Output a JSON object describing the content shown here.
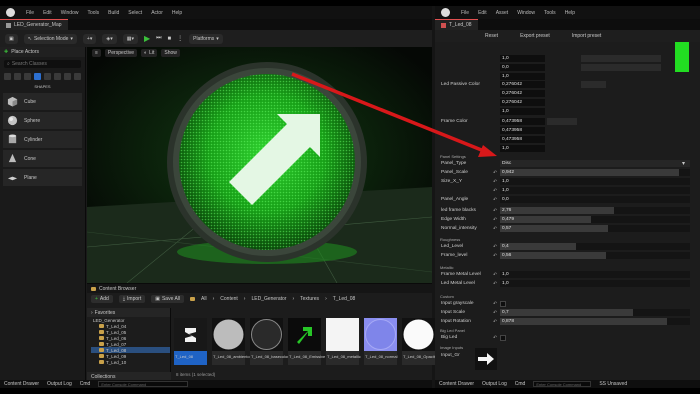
{
  "left_window": {
    "menu": [
      "File",
      "Edit",
      "Window",
      "Tools",
      "Build",
      "Select",
      "Actor",
      "Help"
    ],
    "tab_label": "LED_Generator_Map",
    "toolbar": {
      "selection_mode": "Selection Mode",
      "platforms": "Platforms"
    },
    "place_actors": {
      "title": "Place Actors",
      "search_placeholder": "Search Classes",
      "category": "SHAPES",
      "items": [
        "Cube",
        "Sphere",
        "Cylinder",
        "Cone",
        "Plane"
      ]
    },
    "viewport": {
      "perspective": "Perspective",
      "lit": "Lit",
      "show": "Show"
    },
    "content_browser": {
      "tab": "Content Browser",
      "add": "Add",
      "import": "Import",
      "save_all": "Save All",
      "path": [
        "All",
        "Content",
        "LED_Generator",
        "Textures",
        "T_Led_08"
      ],
      "favorites": "Favorites",
      "root": "LED_Generator",
      "folders": [
        "T_Led_04",
        "T_Led_05",
        "T_Led_06",
        "T_Led_07",
        "T_Led_08",
        "T_Led_09",
        "T_Led_10"
      ],
      "selected_folder": "T_Led_08",
      "collections": "Collections",
      "assets": [
        {
          "label": "T_Led_08"
        },
        {
          "label": "T_Led_08_ambientocclus"
        },
        {
          "label": "T_Led_08_basecolor"
        },
        {
          "label": "T_Led_08_Emissive"
        },
        {
          "label": "T_Led_08_metallic"
        },
        {
          "label": "T_Led_08_normal"
        },
        {
          "label": "T_Led_08_Opacity"
        }
      ],
      "summary": "8 items (1 selected)"
    },
    "status": {
      "drawer": "Content Drawer",
      "log": "Output Log",
      "cmd": "Cmd",
      "console": "Enter Console Command"
    }
  },
  "right_window": {
    "menu": [
      "File",
      "Edit",
      "Asset",
      "Window",
      "Tools",
      "Help"
    ],
    "tab_label": "T_Led_08",
    "toolbar": {
      "reset": "Reset",
      "export": "Export preset",
      "import": "Import preset"
    },
    "top_values": [
      "1,0",
      "0,0",
      "1,0"
    ],
    "passive_color": {
      "name": "Led Passive Color",
      "values": [
        "0,276042",
        "0,276042",
        "0,276042",
        "1,0"
      ]
    },
    "frame_color": {
      "name": "Frame Color",
      "values": [
        "0,473958",
        "0,473958",
        "0,473958",
        "1,0"
      ]
    },
    "sections": {
      "panel": "Panel Settings",
      "roughness": "Roughness",
      "metallic": "Metallic",
      "custom": "Custom",
      "big_led": "Big Led Panel",
      "image_inputs": "Image Inputs"
    },
    "panel_type": {
      "name": "Panel_Type",
      "value": "Disc"
    },
    "params": [
      {
        "name": "Panel_Scale",
        "value": "0,942"
      },
      {
        "name": "Size_X_Y",
        "value": "1,0"
      },
      {
        "name": "",
        "value": "1,0"
      },
      {
        "name": "Panel_Angle",
        "value": "0,0"
      },
      {
        "name": "led frame blacks",
        "value": "2,76"
      },
      {
        "name": "Edge Width",
        "value": "0,479"
      },
      {
        "name": "Normal_intensity",
        "value": "0,57"
      },
      {
        "name": "Led_Level",
        "value": "0,4"
      },
      {
        "name": "Frame_level",
        "value": "0,56"
      },
      {
        "name": "Frame Metal Level",
        "value": "1,0"
      },
      {
        "name": "Led Metal Level",
        "value": "1,0"
      },
      {
        "name": "Input grayscale",
        "value": ""
      },
      {
        "name": "Input Scale",
        "value": "0,7"
      },
      {
        "name": "Input Rotation",
        "value": "0,878"
      },
      {
        "name": "Big Led",
        "value": ""
      }
    ],
    "input_gr": "Input_Gr",
    "status": {
      "drawer": "Content Drawer",
      "log": "Output Log",
      "cmd": "Cmd",
      "console": "Enter Console Command",
      "source": "SS Unsaved"
    }
  },
  "colors": {
    "accent": "#3bc13b",
    "selection": "#1f63c5",
    "green_swatch": "#22dd22",
    "arrow": "#d8181a"
  }
}
